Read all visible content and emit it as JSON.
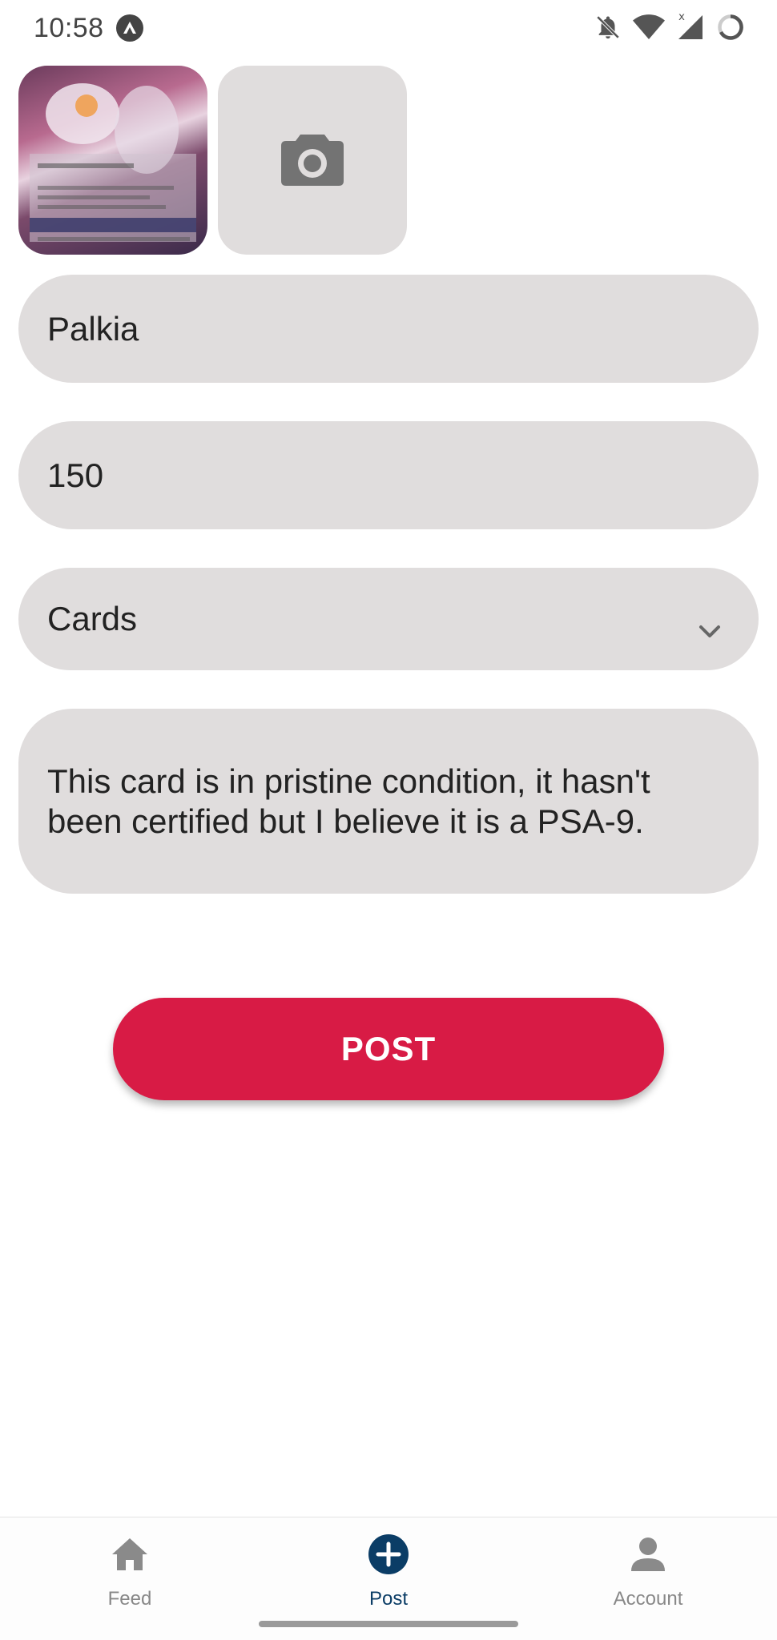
{
  "status_bar": {
    "time": "10:58",
    "icons": [
      "expo-icon",
      "bell-off-icon",
      "wifi-icon",
      "signal-icon",
      "battery-icon"
    ]
  },
  "photos": {
    "thumbnail_alt": "Palkia card photo",
    "add_photo_icon": "camera-icon"
  },
  "form": {
    "title_value": "Palkia",
    "price_value": "150",
    "category_value": "Cards",
    "description_value": "This card is in pristine condition, it hasn't been certified but I believe it is a PSA-9."
  },
  "post_button": {
    "label": "POST"
  },
  "bottom_nav": {
    "items": [
      {
        "label": "Feed",
        "icon": "home-icon",
        "active": false
      },
      {
        "label": "Post",
        "icon": "plus-circle-icon",
        "active": true
      },
      {
        "label": "Account",
        "icon": "person-icon",
        "active": false
      }
    ]
  },
  "colors": {
    "primary": "#d81b45",
    "active_nav": "#0b3d66",
    "field_bg": "#e0dddd",
    "inactive_nav": "#888888"
  }
}
